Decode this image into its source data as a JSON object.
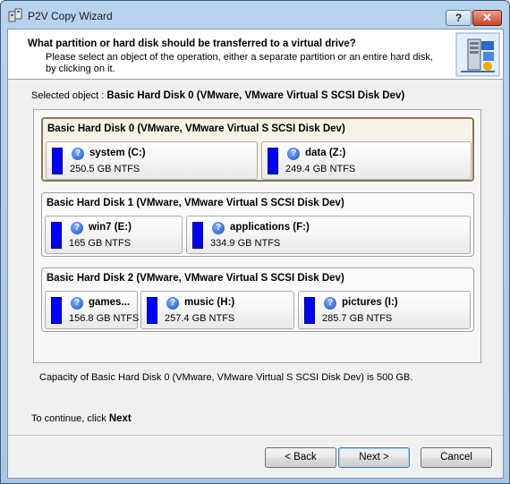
{
  "window": {
    "title": "P2V Copy Wizard",
    "help_label": "?",
    "close_label": "✕"
  },
  "header": {
    "title": "What partition or hard disk should be transferred to a virtual drive?",
    "description": "Please select an object of the operation, either a separate partition or an entire hard disk, by clicking on it."
  },
  "selection": {
    "label": "Selected object :",
    "value": "Basic Hard Disk 0 (VMware, VMware Virtual S SCSI Disk Dev)"
  },
  "disks": [
    {
      "title": "Basic Hard Disk 0 (VMware, VMware Virtual S SCSI Disk Dev)",
      "selected": true,
      "partitions": [
        {
          "name": "system (C:)",
          "size": "250.5 GB NTFS"
        },
        {
          "name": "data (Z:)",
          "size": "249.4 GB NTFS"
        }
      ]
    },
    {
      "title": "Basic Hard Disk 1 (VMware, VMware Virtual S SCSI Disk Dev)",
      "selected": false,
      "partitions": [
        {
          "name": "win7 (E:)",
          "size": "165 GB NTFS"
        },
        {
          "name": "applications (F:)",
          "size": "334.9 GB NTFS"
        }
      ]
    },
    {
      "title": "Basic Hard Disk 2 (VMware, VMware Virtual S SCSI Disk Dev)",
      "selected": false,
      "partitions": [
        {
          "name": "games...",
          "size": "156.8 GB NTFS"
        },
        {
          "name": "music (H:)",
          "size": "257.4 GB NTFS"
        },
        {
          "name": "pictures (I:)",
          "size": "285.7 GB NTFS"
        }
      ]
    }
  ],
  "capacity_text": "Capacity of Basic Hard Disk 0 (VMware, VMware Virtual S SCSI Disk Dev) is 500 GB.",
  "continue": {
    "prefix": "To continue, click",
    "action": "Next"
  },
  "buttons": {
    "back": "< Back",
    "next": "Next >",
    "cancel": "Cancel"
  },
  "colors": {
    "partition_fill": "#0000f5",
    "selected_border": "#8b7757",
    "close_red": "#c7432c"
  },
  "icons": {
    "app": "wizard-app-icon",
    "header": "server-wizard-icon",
    "partition": "question-icon"
  }
}
